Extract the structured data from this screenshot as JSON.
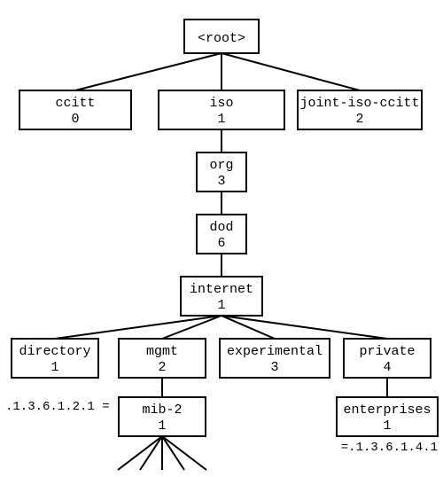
{
  "nodes": {
    "root": {
      "name": "<root>",
      "oid": ""
    },
    "ccitt": {
      "name": "ccitt",
      "oid": "0"
    },
    "iso": {
      "name": "iso",
      "oid": "1"
    },
    "joint": {
      "name": "joint-iso-ccitt",
      "oid": "2"
    },
    "org": {
      "name": "org",
      "oid": "3"
    },
    "dod": {
      "name": "dod",
      "oid": "6"
    },
    "internet": {
      "name": "internet",
      "oid": "1"
    },
    "directory": {
      "name": "directory",
      "oid": "1"
    },
    "mgmt": {
      "name": "mgmt",
      "oid": "2"
    },
    "experimental": {
      "name": "experimental",
      "oid": "3"
    },
    "private": {
      "name": "private",
      "oid": "4"
    },
    "mib2": {
      "name": "mib-2",
      "oid": "1"
    },
    "enterprises": {
      "name": "enterprises",
      "oid": "1"
    }
  },
  "annotations": {
    "mib2_path": ".1.3.6.1.2.1 =",
    "enterprises_path": "=.1.3.6.1.4.1"
  }
}
